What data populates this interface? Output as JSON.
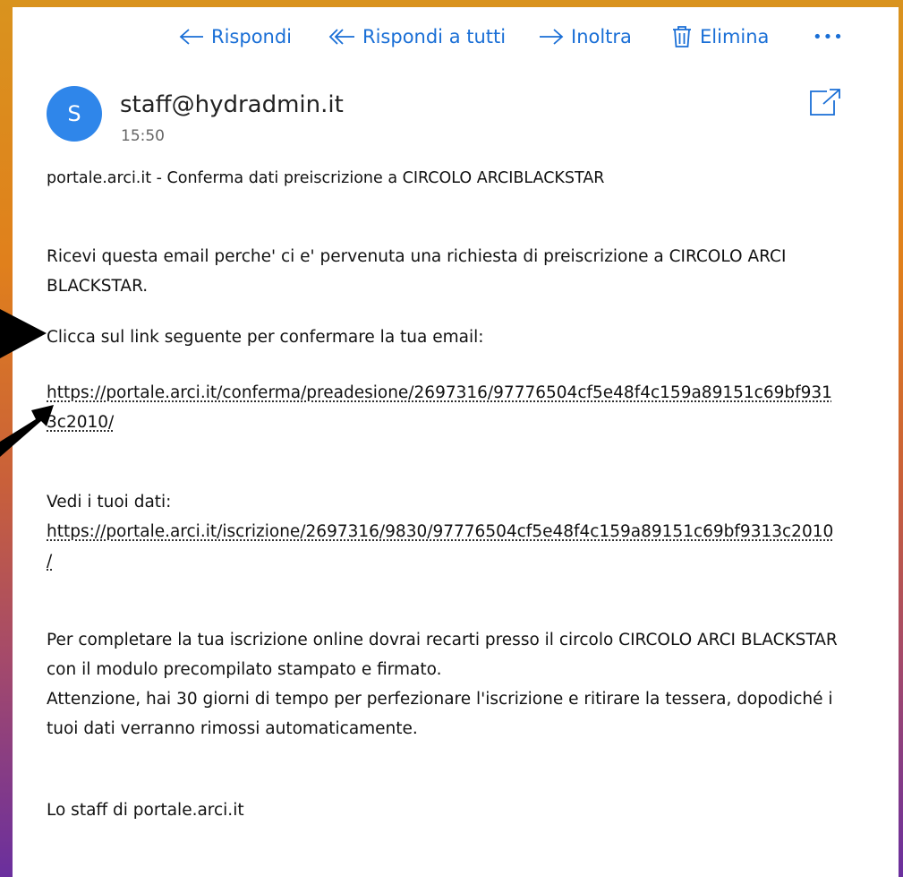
{
  "toolbar": {
    "reply_label": "Rispondi",
    "reply_all_label": "Rispondi a tutti",
    "forward_label": "Inoltra",
    "delete_label": "Elimina",
    "more_label": "•••"
  },
  "message": {
    "avatar_initial": "S",
    "sender": "staff@hydradmin.it",
    "time": "15:50",
    "subject": "portale.arci.it - Conferma dati preiscrizione a CIRCOLO ARCIBLACKSTAR",
    "body_intro_line1": "Ricevi questa email perche' ci e' pervenuta una richiesta di preiscrizione a CIRCOLO ARCI",
    "body_intro_line2": "BLACKSTAR.",
    "confirm_prompt": "Clicca sul link seguente per confermare la tua email:",
    "confirm_link_line1": "https://portale.arci.it/conferma/preadesione/2697316/97776504cf5e48f4c159a89151c69bf931",
    "confirm_link_line2": "3c2010/",
    "view_data_label": "Vedi i tuoi dati:",
    "data_link_line1": "https://portale.arci.it/iscrizione/2697316/9830/97776504cf5e48f4c159a89151c69bf9313c2010",
    "data_link_line2": "/",
    "complete_line1": "Per completare la tua iscrizione online dovrai recarti presso il circolo CIRCOLO ARCI BLACKSTAR",
    "complete_line2": "con il modulo precompilato stampato e firmato.",
    "warning_line1": "Attenzione, hai 30 giorni di tempo per perfezionare l'iscrizione e ritirare la tessera, dopodiché i",
    "warning_line2": "tuoi dati verranno rimossi automaticamente.",
    "signature": "Lo staff di portale.arci.it"
  },
  "colors": {
    "accent": "#1a6fd6",
    "avatar": "#2f86ea"
  }
}
